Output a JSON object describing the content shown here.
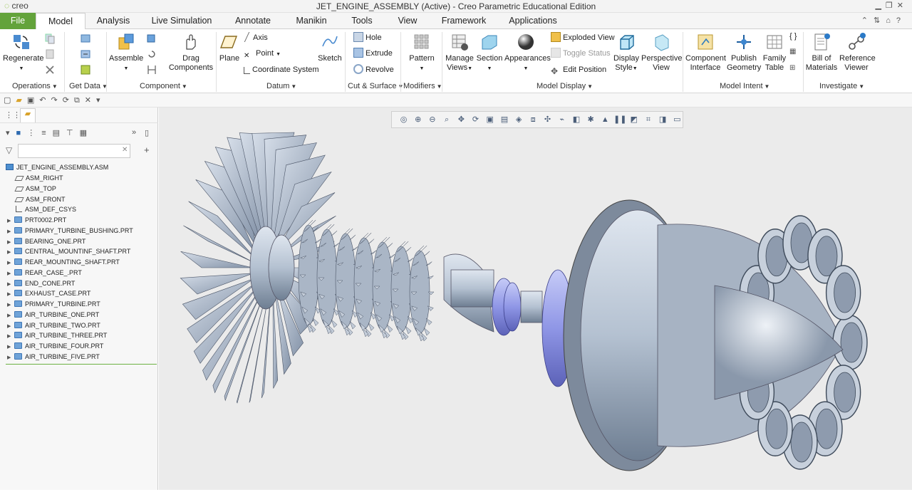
{
  "app": {
    "logo": "creo",
    "title": "JET_ENGINE_ASSEMBLY (Active) - Creo Parametric Educational Edition"
  },
  "tabs": [
    "File",
    "Model",
    "Analysis",
    "Live Simulation",
    "Annotate",
    "Manikin",
    "Tools",
    "View",
    "Framework",
    "Applications"
  ],
  "ribbon": {
    "operations": {
      "label": "Operations",
      "regenerate": "Regenerate"
    },
    "getdata": {
      "label": "Get Data"
    },
    "component": {
      "label": "Component",
      "assemble": "Assemble",
      "drag_1": "Drag",
      "drag_2": "Components"
    },
    "datum": {
      "label": "Datum",
      "plane": "Plane",
      "axis": "Axis",
      "point": "Point",
      "csys": "Coordinate System",
      "sketch": "Sketch"
    },
    "cut": {
      "label": "Cut & Surface",
      "hole": "Hole",
      "extrude": "Extrude",
      "revolve": "Revolve"
    },
    "modifiers": {
      "label": "Modifiers",
      "pattern": "Pattern"
    },
    "display": {
      "label": "Model Display",
      "manage_1": "Manage",
      "manage_2": "Views",
      "section": "Section",
      "appearances": "Appearances",
      "exploded": "Exploded View",
      "toggle": "Toggle Status",
      "edit_pos": "Edit Position",
      "display_1": "Display",
      "display_2": "Style",
      "persp_1": "Perspective",
      "persp_2": "View"
    },
    "intent": {
      "label": "Model Intent",
      "comp_1": "Component",
      "comp_2": "Interface",
      "pub_1": "Publish",
      "pub_2": "Geometry",
      "fam_1": "Family",
      "fam_2": "Table"
    },
    "investigate": {
      "label": "Investigate",
      "bom_1": "Bill of",
      "bom_2": "Materials",
      "ref_1": "Reference",
      "ref_2": "Viewer"
    }
  },
  "tree": {
    "filter_placeholder": "",
    "root": "JET_ENGINE_ASSEMBLY.ASM",
    "datums": [
      "ASM_RIGHT",
      "ASM_TOP",
      "ASM_FRONT",
      "ASM_DEF_CSYS"
    ],
    "parts": [
      "PRT0002.PRT",
      "PRIMARY_TURBINE_BUSHING.PRT",
      "BEARING_ONE.PRT",
      "CENTRAL_MOUNTINF_SHAFT.PRT",
      "REAR_MOUNTING_SHAFT.PRT",
      "REAR_CASE_.PRT",
      "END_CONE.PRT",
      "EXHAUST_CASE.PRT",
      "PRIMARY_TURBINE.PRT",
      "AIR_TURBINE_ONE.PRT",
      "AIR_TURBINE_TWO.PRT",
      "AIR_TURBINE_THREE.PRT",
      "AIR_TURBINE_FOUR.PRT",
      "AIR_TURBINE_FIVE.PRT"
    ]
  },
  "colors": {
    "file_tab": "#63a33b",
    "model_steel": "#b4c1d1",
    "bearing_blue": "#8f96e6",
    "canvas_bg": "#ebebeb"
  }
}
